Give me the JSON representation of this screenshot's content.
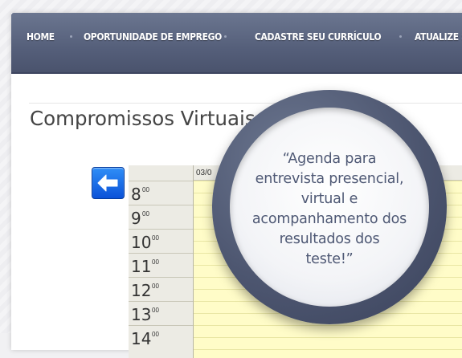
{
  "nav": {
    "items": [
      "HOME",
      "OPORTUNIDADE DE EMPREGO",
      "CADASTRE SEU CURRÍCULO",
      "ATUALIZE S"
    ]
  },
  "page": {
    "title": "Compromissos Virtuais"
  },
  "calendar": {
    "date_label": "03/0",
    "hours": [
      {
        "h": "8",
        "m": "00"
      },
      {
        "h": "9",
        "m": "00"
      },
      {
        "h": "10",
        "m": "00"
      },
      {
        "h": "11",
        "m": "00"
      },
      {
        "h": "12",
        "m": "00"
      },
      {
        "h": "13",
        "m": "00"
      },
      {
        "h": "14",
        "m": "00"
      }
    ]
  },
  "callout": {
    "lines": [
      "“Agenda para",
      "entrevista presencial,",
      "virtual e",
      "acompanhamento dos",
      "resultados dos",
      "teste!”"
    ]
  },
  "icons": {
    "back": "arrow-left-icon"
  },
  "colors": {
    "nav_bg": "#555f7a",
    "bubble_text": "#4e5874",
    "calendar_bg": "#fffcc8",
    "back_button": "#1a6ee8"
  }
}
